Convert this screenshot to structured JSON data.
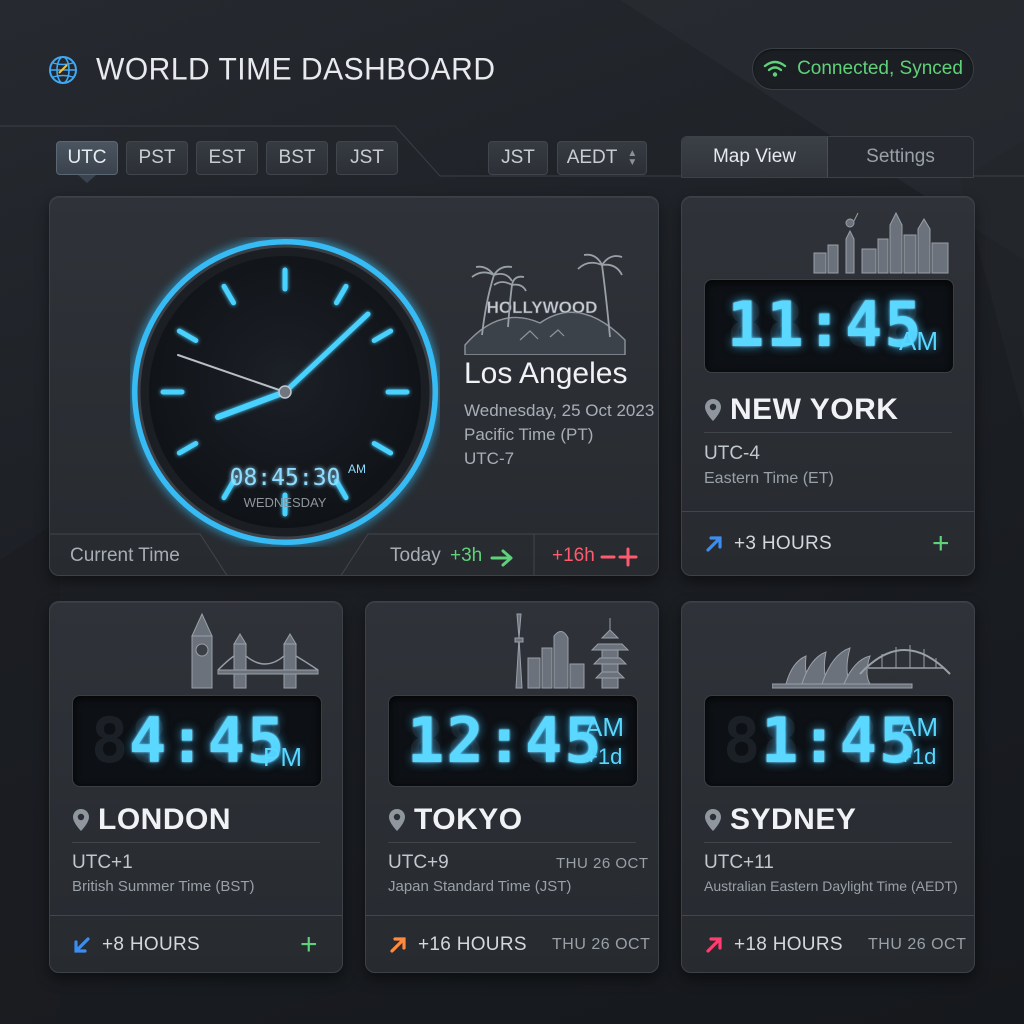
{
  "header": {
    "title": "WORLD TIME DASHBOARD",
    "status": "Connected, Synced"
  },
  "toolbar": {
    "timezones": [
      "UTC",
      "PST",
      "EST",
      "BST",
      "JST"
    ],
    "selected": "UTC",
    "zone_select_1": "JST",
    "zone_select_2": "AEDT"
  },
  "view_tabs": [
    "Map View",
    "Settings"
  ],
  "main_clock": {
    "digital_time": "08:45:30",
    "ampm": "AM",
    "day": "WEDNESDAY",
    "sign": "HOLLYWOOD",
    "city": "Los Angeles",
    "date": "Wednesday, 25 Oct 2023",
    "zone": "Pacific Time (PT)",
    "utc": "UTC-7",
    "footer_label": "Current Time",
    "today_label": "Today",
    "today_offset": "+3h",
    "future_offset": "+16h"
  },
  "cities": {
    "new_york": {
      "time": "11:45",
      "suffix": "AM",
      "name": "NEW YORK",
      "utc": "UTC-4",
      "zone": "Eastern Time (ET)",
      "offset": "+3 HOURS"
    },
    "london": {
      "time": "4:45",
      "suffix": "PM",
      "name": "LONDON",
      "utc": "UTC+1",
      "zone": "British Summer Time (BST)",
      "offset": "+8 HOURS"
    },
    "tokyo": {
      "time": "12:45",
      "suffix": "AM",
      "day_shift": "+1d",
      "name": "TOKYO",
      "utc": "UTC+9",
      "date": "THU 26 OCT",
      "zone": "Japan Standard Time (JST)",
      "offset": "+16 HOURS",
      "foot_date": "THU 26 OCT"
    },
    "sydney": {
      "time": "1:45",
      "suffix": "AM",
      "day_shift": "+1d",
      "name": "SYDNEY",
      "utc": "UTC+11",
      "zone": "Australian Eastern Daylight Time (AEDT)",
      "offset": "+18 HOURS",
      "foot_date": "THU 26 OCT"
    }
  },
  "colors": {
    "accent_cyan": "#5ad8ff",
    "green": "#5fd17a",
    "red": "#ff5a6e",
    "blue_arrow": "#3d8cf0",
    "orange_arrow": "#ff8a3d",
    "pink_arrow": "#ff3d6e"
  }
}
